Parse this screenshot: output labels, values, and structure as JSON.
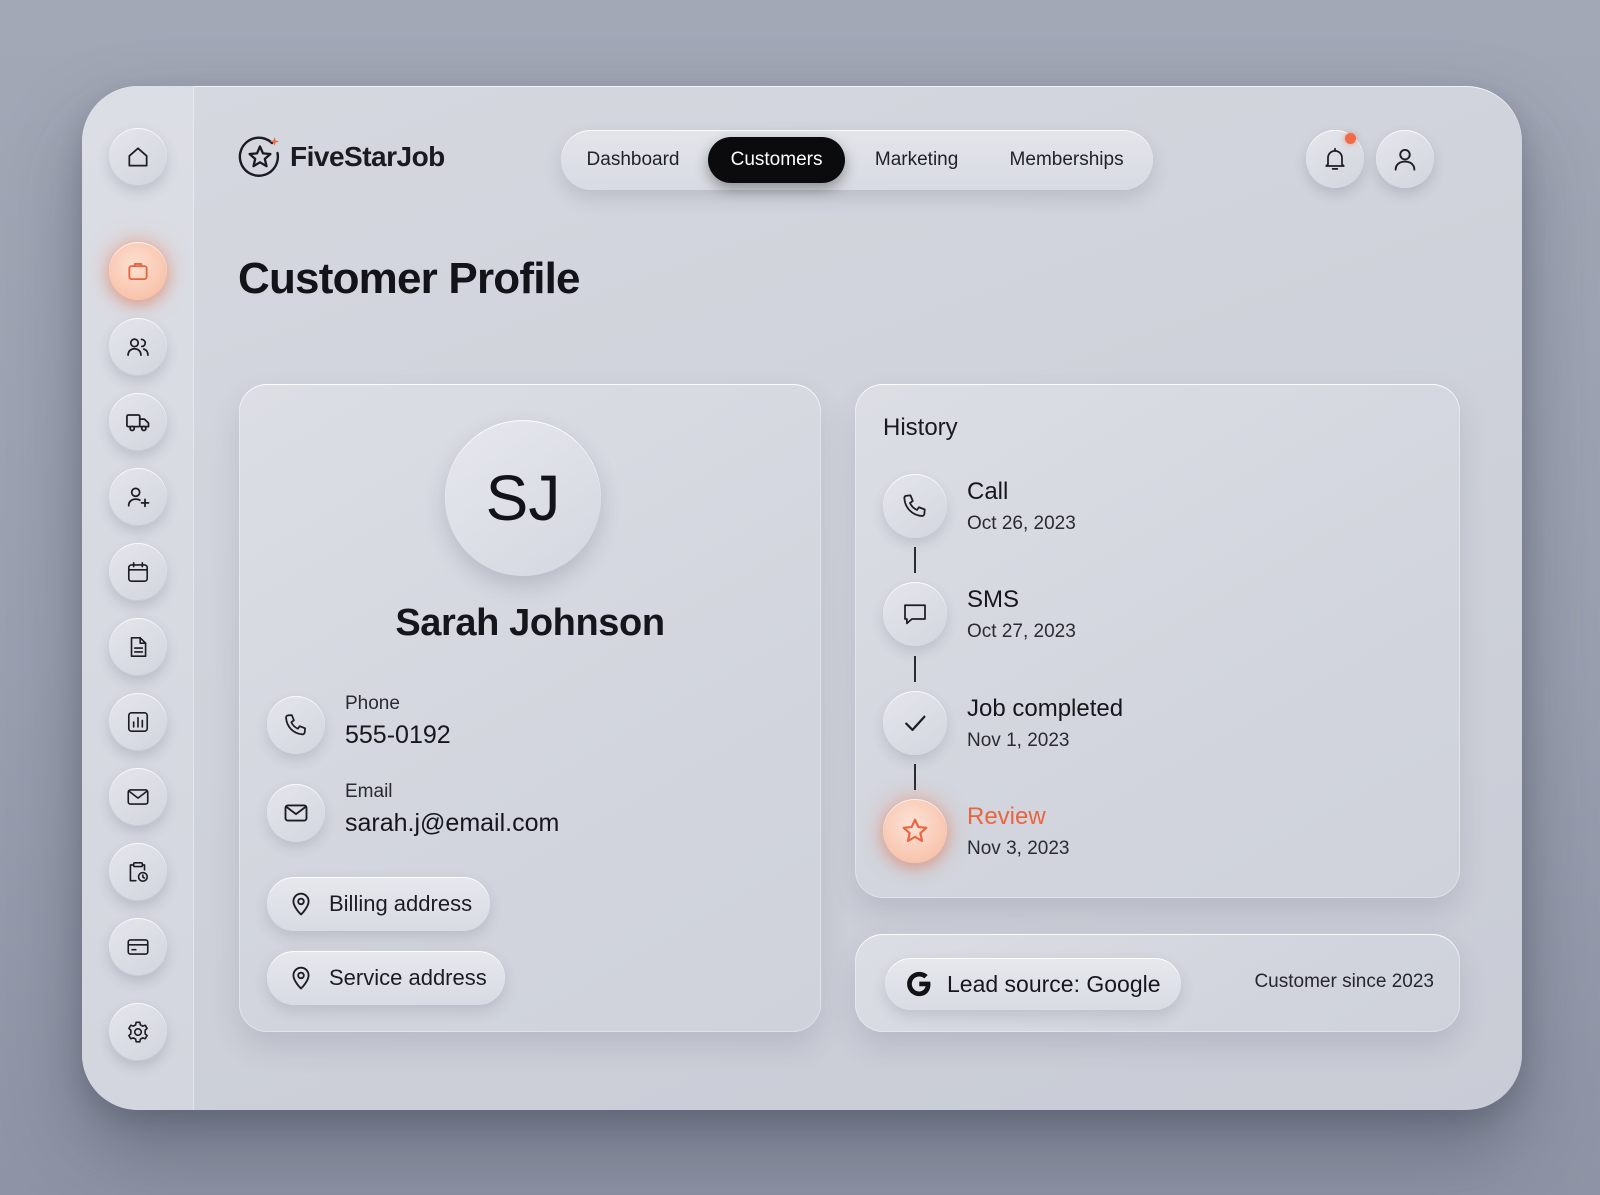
{
  "app": {
    "name": "FiveStarJob"
  },
  "colors": {
    "accent": "#EF6A45",
    "active_tab_bg": "#0B0B0E"
  },
  "sidebar": {
    "items": [
      {
        "icon": "home-icon",
        "active": false
      },
      {
        "icon": "briefcase-icon",
        "active": true
      },
      {
        "icon": "users-icon",
        "active": false
      },
      {
        "icon": "truck-icon",
        "active": false
      },
      {
        "icon": "user-plus-icon",
        "active": false
      },
      {
        "icon": "calendar-icon",
        "active": false
      },
      {
        "icon": "document-icon",
        "active": false
      },
      {
        "icon": "bar-chart-icon",
        "active": false
      },
      {
        "icon": "mail-icon",
        "active": false
      },
      {
        "icon": "clipboard-clock-icon",
        "active": false
      },
      {
        "icon": "credit-card-icon",
        "active": false
      },
      {
        "icon": "settings-icon",
        "active": false
      }
    ]
  },
  "nav": {
    "tabs": [
      {
        "label": "Dashboard",
        "active": false
      },
      {
        "label": "Customers",
        "active": true
      },
      {
        "label": "Marketing",
        "active": false
      },
      {
        "label": "Memberships",
        "active": false
      }
    ]
  },
  "header": {
    "notifications_icon": "bell-icon",
    "has_unread": true,
    "profile_icon": "user-icon"
  },
  "page": {
    "title": "Customer Profile"
  },
  "profile": {
    "initials": "SJ",
    "name": "Sarah Johnson",
    "phone_label": "Phone",
    "phone": "555-0192",
    "email_label": "Email",
    "email": "sarah.j@email.com",
    "billing_label": "Billing address",
    "service_label": "Service address"
  },
  "history": {
    "title": "History",
    "items": [
      {
        "title": "Call",
        "date": "Oct 26, 2023",
        "icon": "phone-icon"
      },
      {
        "title": "SMS",
        "date": "Oct 27, 2023",
        "icon": "message-icon"
      },
      {
        "title": "Job completed",
        "date": "Nov 1, 2023",
        "icon": "check-icon"
      },
      {
        "title": "Review",
        "date": "Nov 3, 2023",
        "icon": "star-icon"
      }
    ]
  },
  "lead": {
    "source_label": "Lead source: Google",
    "source_icon": "google-icon",
    "customer_since": "Customer since 2023"
  }
}
